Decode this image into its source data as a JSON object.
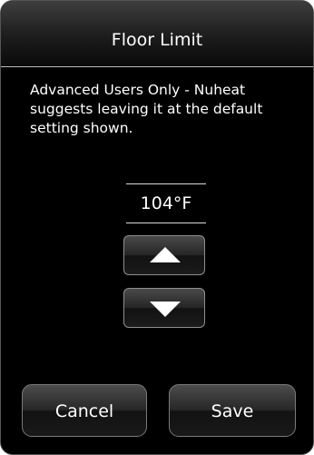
{
  "header": {
    "title": "Floor Limit"
  },
  "message": "Advanced Users Only - Nuheat suggests leaving it at the default setting shown.",
  "setting": {
    "value": "104°F"
  },
  "controls": {
    "increase_icon": "triangle-up",
    "decrease_icon": "triangle-down"
  },
  "buttons": {
    "cancel_label": "Cancel",
    "save_label": "Save"
  },
  "colors": {
    "background": "#000000",
    "text": "#ffffff",
    "divider": "#d9d9d9"
  }
}
